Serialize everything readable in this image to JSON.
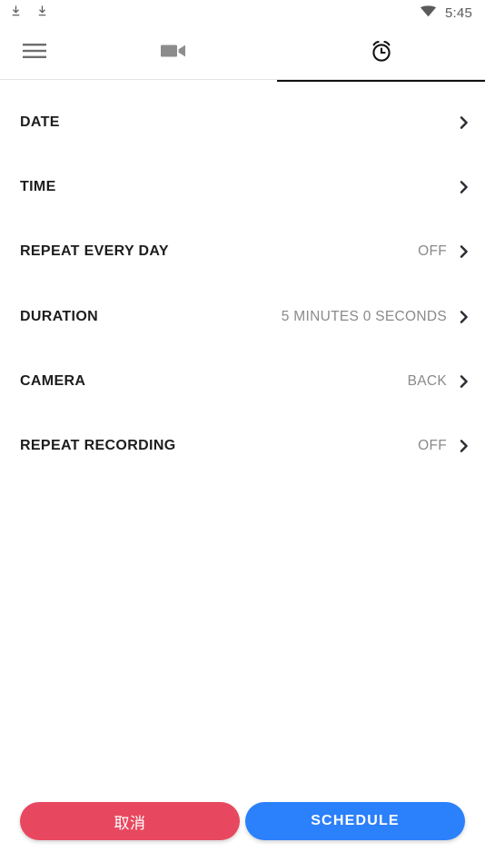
{
  "status_bar": {
    "left_icons": [
      {
        "name": "download-icon"
      },
      {
        "name": "download-icon"
      }
    ],
    "wifi_icon": "wifi-icon",
    "time": "5:45"
  },
  "tab_bar": {
    "menu_icon": "hamburger-menu-icon",
    "tabs": [
      {
        "icon": "video-camera-icon",
        "name": "tab-video",
        "selected": false
      },
      {
        "icon": "alarm-clock-icon",
        "name": "tab-alarm",
        "selected": true
      }
    ]
  },
  "settings": {
    "rows": [
      {
        "label": "DATE",
        "value": "",
        "chevron": "chevron-right-icon"
      },
      {
        "label": "TIME",
        "value": "",
        "chevron": "chevron-right-icon"
      },
      {
        "label": "REPEAT EVERY DAY",
        "value": "OFF",
        "chevron": "chevron-right-icon"
      },
      {
        "label": "DURATION",
        "value": "5 MINUTES 0 SECONDS",
        "chevron": "chevron-right-icon"
      },
      {
        "label": "CAMERA",
        "value": "BACK",
        "chevron": "chevron-right-icon"
      },
      {
        "label": "REPEAT RECORDING",
        "value": "OFF",
        "chevron": "chevron-right-icon"
      }
    ]
  },
  "buttons": {
    "cancel_label": "取消",
    "schedule_label": "SCHEDULE"
  },
  "colors": {
    "cancel_bg": "#e8485f",
    "schedule_bg": "#2b80fb",
    "tab_indicator": "#111111",
    "label_text": "#1d1d1d",
    "value_text": "#8a8a8a"
  }
}
